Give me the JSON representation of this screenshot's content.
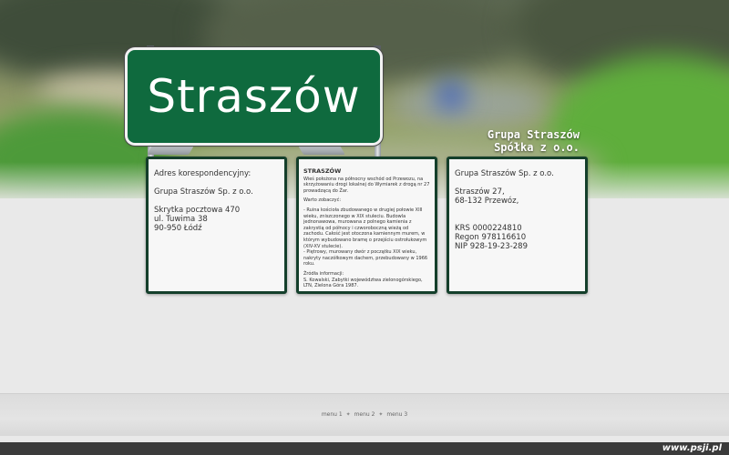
{
  "sign": {
    "text": "Straszów"
  },
  "company": {
    "line1": "Grupa Straszów",
    "line2": "Spółka z o.o."
  },
  "panel_left": {
    "heading": "Adres korespondencyjny:",
    "company_name": "Grupa Straszów Sp. z o.o.",
    "address_line1": "Skrytka pocztowa 470",
    "address_line2": "ul. Tuwima 38",
    "address_line3": "90-950 Łódź"
  },
  "panel_middle": {
    "title": "STRASZÓW",
    "intro": "Wieś położona na północny wschód od Przewozu, na skrzyżowaniu drogi lokalnej do Wymiarek z drogą nr 27 prowadzącą do Żar.",
    "see_heading": "Warto zobaczyć:",
    "item1": "- Ruina kościoła zbudowanego w drugiej połowie XIII wieku, zniszczonego w XIX stuleciu. Budowla jednonawowa, murowana z polnego kamienia z zakrystią od północy i czworoboczną wieżą od zachodu. Całość jest otoczona kamiennym murem, w którym wybudowano bramę o przejściu ostrołukowym (XIV-XV stulecie).",
    "item2": "- Piętrowy, murowany dwór z początku XIX wieku, nakryty naczółkowym dachem, przebudowany w 1966 roku.",
    "sources_heading": "Źródła informacji:",
    "source1": "S. Kowalski, Zabytki województwa zielonogórskiego, LTN, Zielona Góra 1987."
  },
  "panel_right": {
    "company_name": "Grupa Straszów Sp. z o.o.",
    "street": "Straszów 27,",
    "city": "68-132 Przewóz,",
    "krs": "KRS 0000224810",
    "regon": "Regon 978116610",
    "nip": "NIP 928-19-23-289"
  },
  "menu": {
    "item1": "menu 1",
    "item2": "menu 2",
    "item3": "menu 3",
    "separator": "✦"
  },
  "footer": {
    "credit": "www.psji.pl"
  },
  "colors": {
    "sign_green": "#0f6a3e",
    "panel_border": "#143f2b",
    "bottom_bar": "#3b3b3b"
  }
}
